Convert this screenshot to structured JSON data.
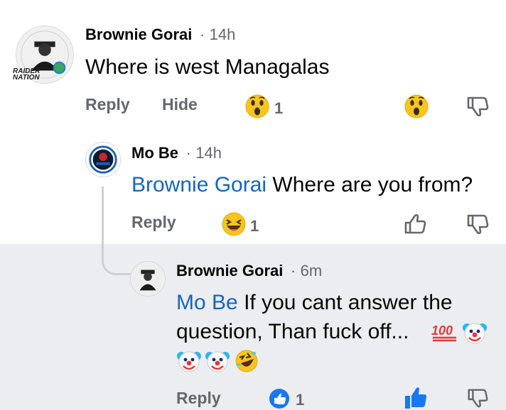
{
  "colors": {
    "mention": "#1565c0",
    "secondary_text": "#65676b",
    "highlight_bg": "#ebedf0",
    "like_blue": "#1877f2"
  },
  "comment1": {
    "author": "Brownie Gorai",
    "time": "14h",
    "text": "Where is west Managalas",
    "avatar_caption": "RAIDER NATION",
    "reply_label": "Reply",
    "hide_label": "Hide",
    "reaction_icon": "wow-emoji-icon",
    "reaction_count": "1"
  },
  "comment2": {
    "author": "Mo Be",
    "time": "14h",
    "mention": "Brownie Gorai",
    "text": "Where are you from?",
    "reply_label": "Reply",
    "reaction_icon": "haha-emoji-icon",
    "reaction_count": "1"
  },
  "comment3": {
    "author": "Brownie Gorai",
    "time": "6m",
    "mention": "Mo Be",
    "text_line1": "If you cant answer the",
    "text_line2": "question,  Than fuck off...",
    "emojis": [
      "hundred-points-emoji",
      "clown-emoji",
      "clown-emoji",
      "clown-emoji",
      "rofl-emoji"
    ],
    "reply_label": "Reply",
    "reaction_icon": "like-reaction-icon",
    "reaction_count": "1"
  },
  "separator": "·"
}
